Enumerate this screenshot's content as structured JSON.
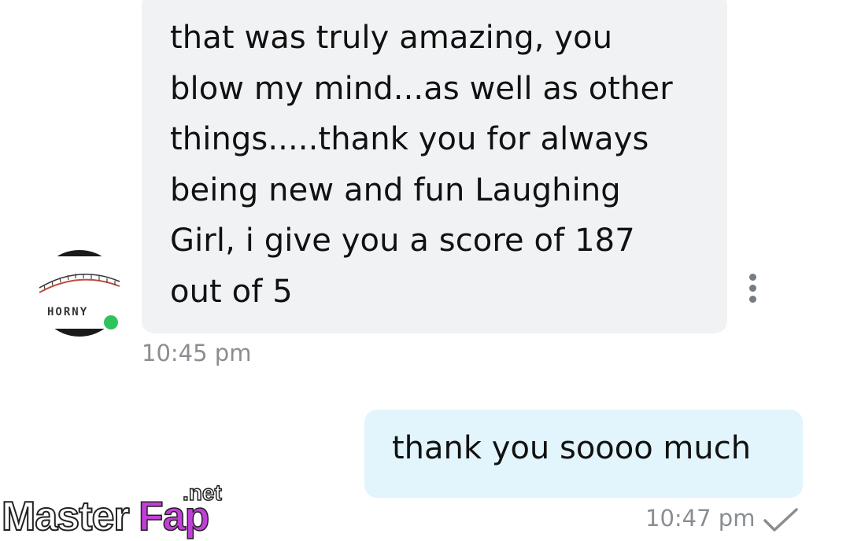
{
  "conversation": {
    "incoming": {
      "text": "that was truly amazing, you\nblow my mind...as well as other\nthings.....thank you for always\nbeing new and fun Laughing\nGirl, i give you a score of 187\nout of 5",
      "time": "10:45 pm",
      "avatar_label": "HORNY",
      "online": true
    },
    "outgoing": {
      "text": "thank you soooo much",
      "time": "10:47 pm",
      "status": "sent-check"
    }
  },
  "watermark": {
    "word_left": "Master",
    "word_right": "Fap",
    "suffix": ".net"
  },
  "colors": {
    "incoming_bubble": "#f1f2f4",
    "outgoing_bubble": "#e2f4fc",
    "online_dot": "#2ec45a",
    "timestamp": "#8a8d92"
  },
  "icons": [
    "more-vertical-icon",
    "check-icon"
  ]
}
